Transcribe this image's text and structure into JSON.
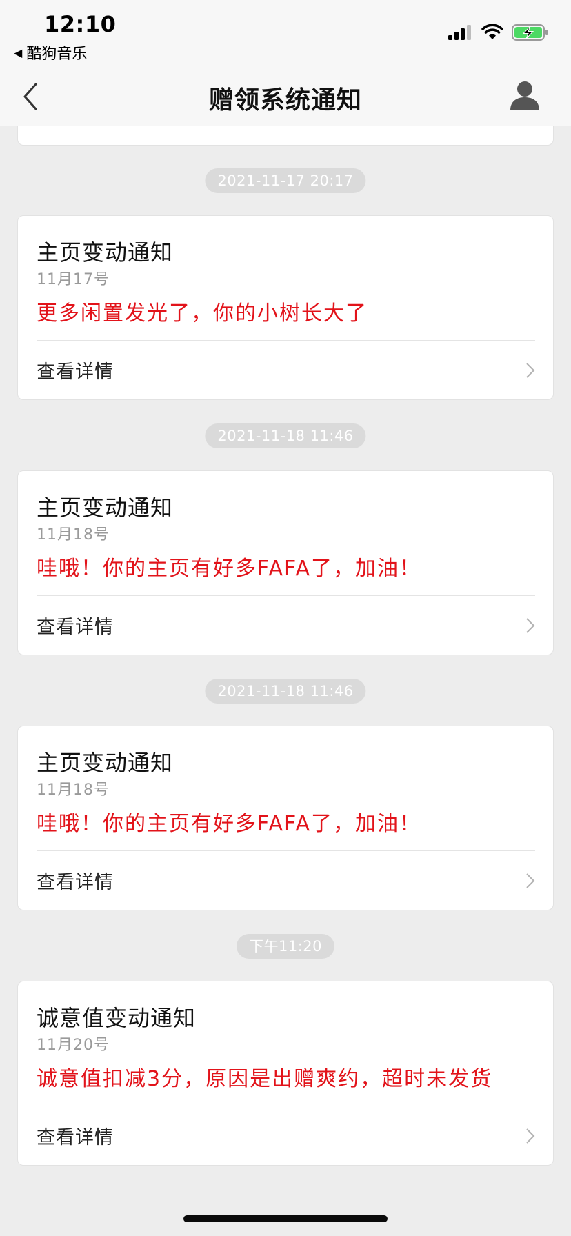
{
  "status_bar": {
    "time": "12:10",
    "back_app": "酷狗音乐",
    "icons": [
      "cellular-signal-icon",
      "wifi-icon",
      "battery-charging-icon"
    ]
  },
  "nav": {
    "title": "赠领系统通知",
    "back_icon": "chevron-left-icon",
    "profile_icon": "person-icon"
  },
  "timeline": [
    {
      "time": "2021-11-17 20:17",
      "title": "主页变动通知",
      "date": "11月17号",
      "message": "更多闲置发光了，你的小树长大了",
      "link": "查看详情"
    },
    {
      "time": "2021-11-18 11:46",
      "title": "主页变动通知",
      "date": "11月18号",
      "message": "哇哦！你的主页有好多FAFA了，加油！",
      "link": "查看详情"
    },
    {
      "time": "2021-11-18 11:46",
      "title": "主页变动通知",
      "date": "11月18号",
      "message": "哇哦！你的主页有好多FAFA了，加油！",
      "link": "查看详情"
    },
    {
      "time": "下午11:20",
      "title": "诚意值变动通知",
      "date": "11月20号",
      "message": "诚意值扣减3分，原因是出赠爽约，超时未发货",
      "link": "查看详情"
    }
  ],
  "colors": {
    "background": "#ededed",
    "card": "#ffffff",
    "message_red": "#e2131a",
    "time_pill": "#dadada",
    "battery_green": "#4cd964"
  }
}
